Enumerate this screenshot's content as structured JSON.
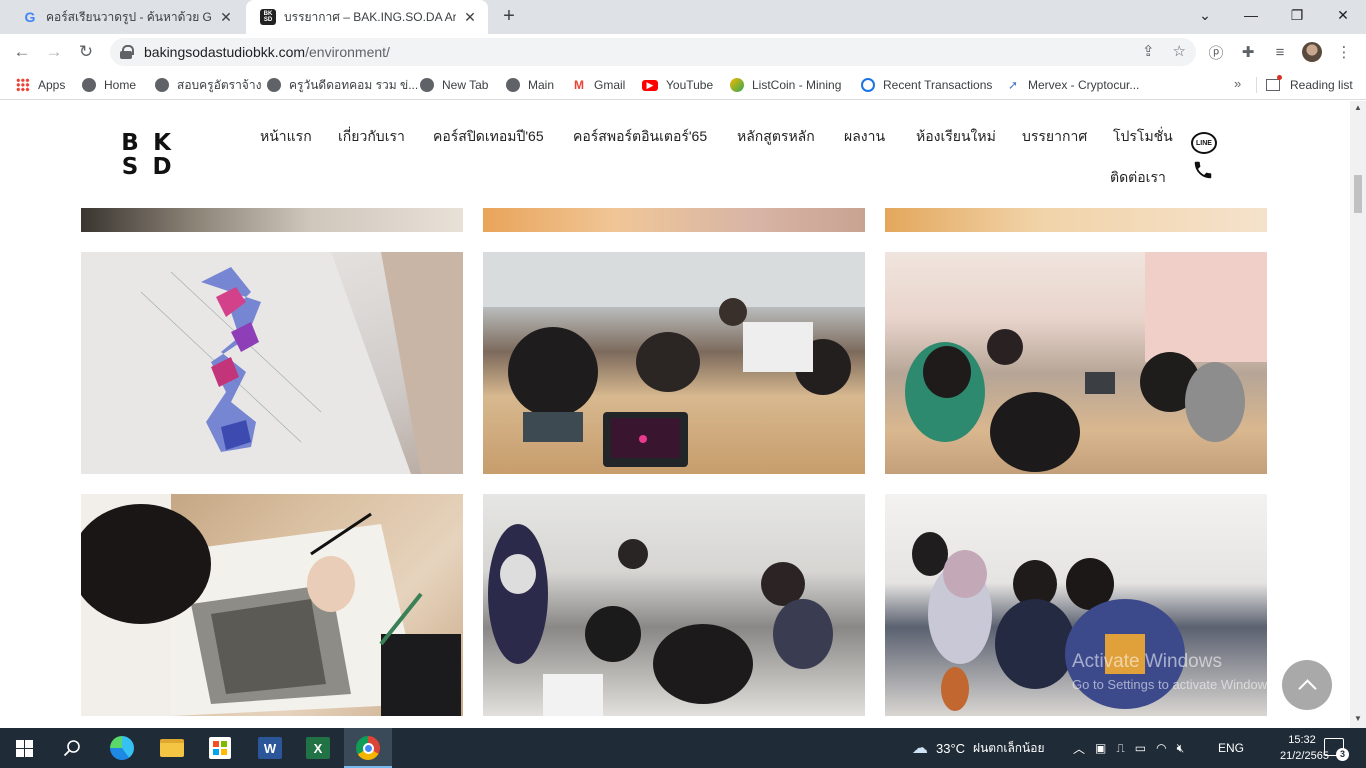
{
  "browser": {
    "tabs": [
      {
        "title": "คอร์สเรียนวาดรูป - ค้นหาด้วย Google",
        "favicon": "google-icon",
        "active": false
      },
      {
        "title": "บรรยากาศ – BAK.ING.SO.DA Artho",
        "favicon": "bksd-icon",
        "active": true
      }
    ],
    "new_tab_symbol": "+",
    "url": {
      "host": "bakingsodastudiobkk.com",
      "path": "/environment/"
    },
    "bookmarks": [
      {
        "label": "Apps",
        "icon": "apps-grid-icon"
      },
      {
        "label": "Home",
        "icon": "globe-icon"
      },
      {
        "label": "สอบครูอัตราจ้าง",
        "icon": "globe-icon"
      },
      {
        "label": "ครูวันดีดอทคอม รวม ข่...",
        "icon": "globe-icon"
      },
      {
        "label": "New Tab",
        "icon": "globe-icon"
      },
      {
        "label": "Main",
        "icon": "globe-icon"
      },
      {
        "label": "Gmail",
        "icon": "gmail-icon"
      },
      {
        "label": "YouTube",
        "icon": "youtube-icon"
      },
      {
        "label": "ListCoin - Mining",
        "icon": "listcoin-icon"
      },
      {
        "label": "Recent Transactions",
        "icon": "transactions-icon"
      },
      {
        "label": "Mervex - Cryptocur...",
        "icon": "mervex-icon"
      }
    ],
    "bookmarks_overflow": "»",
    "reading_list": "Reading list"
  },
  "site": {
    "logo": [
      "B",
      "K",
      "S",
      "D"
    ],
    "nav": [
      "หน้าแรก",
      "เกี่ยวกับเรา",
      "คอร์สปิดเทอมปี'65",
      "คอร์สพอร์ตอินเตอร์'65",
      "หลักสูตรหลัก",
      "ผลงาน",
      "ห้องเรียนใหม่",
      "บรรยากาศ",
      "โปรโมชั่น",
      "ติดต่อเรา"
    ],
    "line_label": "LINE",
    "watermark": {
      "title": "Activate Windows",
      "subtitle": "Go to Settings to activate Windows."
    }
  },
  "taskbar": {
    "weather": {
      "temp": "33°C",
      "desc": "ฝนตกเล็กน้อย"
    },
    "lang": "ENG",
    "time": "15:32",
    "date": "21/2/2565",
    "notifications": "3"
  }
}
